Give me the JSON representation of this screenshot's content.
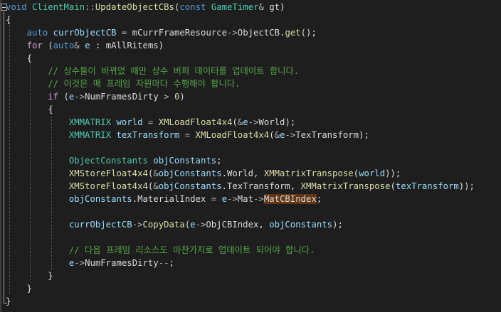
{
  "editor": {
    "lines": [
      [
        [
          "kw",
          "void"
        ],
        [
          "pl",
          " "
        ],
        [
          "ty",
          "ClientMain"
        ],
        [
          "op",
          "::"
        ],
        [
          "fn",
          "UpdateObjectCBs"
        ],
        [
          "pl",
          "("
        ],
        [
          "kw",
          "const"
        ],
        [
          "pl",
          " "
        ],
        [
          "ty",
          "GameTimer"
        ],
        [
          "op",
          "&"
        ],
        [
          "pl",
          " gt)"
        ]
      ],
      [
        [
          "pl",
          "{"
        ]
      ],
      [
        [
          "pl",
          "    "
        ],
        [
          "kw",
          "auto"
        ],
        [
          "pl",
          " "
        ],
        [
          "vr",
          "currObjectCB"
        ],
        [
          "pl",
          " "
        ],
        [
          "op",
          "="
        ],
        [
          "pl",
          " "
        ],
        [
          "mb",
          "mCurrFrameResource"
        ],
        [
          "op",
          "->"
        ],
        [
          "mb",
          "ObjectCB"
        ],
        [
          "pl",
          "."
        ],
        [
          "fn",
          "get"
        ],
        [
          "pl",
          "();"
        ]
      ],
      [
        [
          "pl",
          "    "
        ],
        [
          "kw2",
          "for"
        ],
        [
          "pl",
          " ("
        ],
        [
          "kw",
          "auto"
        ],
        [
          "op",
          "&"
        ],
        [
          "pl",
          " "
        ],
        [
          "vr",
          "e"
        ],
        [
          "pl",
          " : "
        ],
        [
          "mb",
          "mAllRitems"
        ],
        [
          "pl",
          ")"
        ]
      ],
      [
        [
          "pl",
          "    {"
        ]
      ],
      [
        [
          "pl",
          "        "
        ],
        [
          "cm",
          "// 상수들이 바뀌었 때만 상수 버퍼 데이터를 업데이트 합니다."
        ]
      ],
      [
        [
          "pl",
          "        "
        ],
        [
          "cm",
          "// 이것은 매 프레임 자원마다 수행해야 합니다."
        ]
      ],
      [
        [
          "pl",
          "        "
        ],
        [
          "kw2",
          "if"
        ],
        [
          "pl",
          " ("
        ],
        [
          "vr",
          "e"
        ],
        [
          "op",
          "->"
        ],
        [
          "mb",
          "NumFramesDirty"
        ],
        [
          "pl",
          " "
        ],
        [
          "op",
          ">"
        ],
        [
          "pl",
          " "
        ],
        [
          "nm",
          "0"
        ],
        [
          "pl",
          ")"
        ]
      ],
      [
        [
          "pl",
          "        {"
        ]
      ],
      [
        [
          "pl",
          "            "
        ],
        [
          "ty",
          "XMMATRIX"
        ],
        [
          "pl",
          " "
        ],
        [
          "vr",
          "world"
        ],
        [
          "pl",
          " "
        ],
        [
          "op",
          "="
        ],
        [
          "pl",
          " "
        ],
        [
          "fn",
          "XMLoadFloat4x4"
        ],
        [
          "pl",
          "("
        ],
        [
          "op",
          "&"
        ],
        [
          "vr",
          "e"
        ],
        [
          "op",
          "->"
        ],
        [
          "mb",
          "World"
        ],
        [
          "pl",
          ");"
        ]
      ],
      [
        [
          "pl",
          "            "
        ],
        [
          "ty",
          "XMMATRIX"
        ],
        [
          "pl",
          " "
        ],
        [
          "vr",
          "texTransform"
        ],
        [
          "pl",
          " "
        ],
        [
          "op",
          "="
        ],
        [
          "pl",
          " "
        ],
        [
          "fn",
          "XMLoadFloat4x4"
        ],
        [
          "pl",
          "("
        ],
        [
          "op",
          "&"
        ],
        [
          "vr",
          "e"
        ],
        [
          "op",
          "->"
        ],
        [
          "mb",
          "TexTransform"
        ],
        [
          "pl",
          ");"
        ]
      ],
      [],
      [
        [
          "pl",
          "            "
        ],
        [
          "ty",
          "ObjectConstants"
        ],
        [
          "pl",
          " "
        ],
        [
          "vr",
          "objConstants"
        ],
        [
          "pl",
          ";"
        ]
      ],
      [
        [
          "pl",
          "            "
        ],
        [
          "fn",
          "XMStoreFloat4x4"
        ],
        [
          "pl",
          "("
        ],
        [
          "op",
          "&"
        ],
        [
          "vr",
          "objConstants"
        ],
        [
          "pl",
          "."
        ],
        [
          "mb",
          "World"
        ],
        [
          "pl",
          ", "
        ],
        [
          "fn",
          "XMMatrixTranspose"
        ],
        [
          "pl",
          "("
        ],
        [
          "vr",
          "world"
        ],
        [
          "pl",
          "));"
        ]
      ],
      [
        [
          "pl",
          "            "
        ],
        [
          "fn",
          "XMStoreFloat4x4"
        ],
        [
          "pl",
          "("
        ],
        [
          "op",
          "&"
        ],
        [
          "vr",
          "objConstants"
        ],
        [
          "pl",
          "."
        ],
        [
          "mb",
          "TexTransform"
        ],
        [
          "pl",
          ", "
        ],
        [
          "fn",
          "XMMatrixTranspose"
        ],
        [
          "pl",
          "("
        ],
        [
          "vr",
          "texTransform"
        ],
        [
          "pl",
          "));"
        ]
      ],
      [
        [
          "pl",
          "            "
        ],
        [
          "vr",
          "objConstants"
        ],
        [
          "pl",
          "."
        ],
        [
          "mb",
          "MaterialIndex"
        ],
        [
          "pl",
          " "
        ],
        [
          "op",
          "="
        ],
        [
          "pl",
          " "
        ],
        [
          "vr",
          "e"
        ],
        [
          "op",
          "->"
        ],
        [
          "mb",
          "Mat"
        ],
        [
          "op",
          "->"
        ],
        [
          "hl",
          "MatCBIndex"
        ],
        [
          "pl",
          ";"
        ]
      ],
      [],
      [
        [
          "pl",
          "            "
        ],
        [
          "vr",
          "currObjectCB"
        ],
        [
          "op",
          "->"
        ],
        [
          "fn",
          "CopyData"
        ],
        [
          "pl",
          "("
        ],
        [
          "vr",
          "e"
        ],
        [
          "op",
          "->"
        ],
        [
          "mb",
          "ObjCBIndex"
        ],
        [
          "pl",
          ", "
        ],
        [
          "vr",
          "objConstants"
        ],
        [
          "pl",
          ");"
        ]
      ],
      [],
      [
        [
          "pl",
          "            "
        ],
        [
          "cm",
          "// 다음 프레임 리소스도 마찬가지로 업데이트 되어야 합니다."
        ]
      ],
      [
        [
          "pl",
          "            "
        ],
        [
          "vr",
          "e"
        ],
        [
          "op",
          "->"
        ],
        [
          "mb",
          "NumFramesDirty"
        ],
        [
          "op",
          "--"
        ],
        [
          "pl",
          ";"
        ]
      ],
      [
        [
          "pl",
          "        }"
        ]
      ],
      [
        [
          "pl",
          "    }"
        ]
      ],
      [
        [
          "pl",
          "}"
        ]
      ]
    ]
  }
}
